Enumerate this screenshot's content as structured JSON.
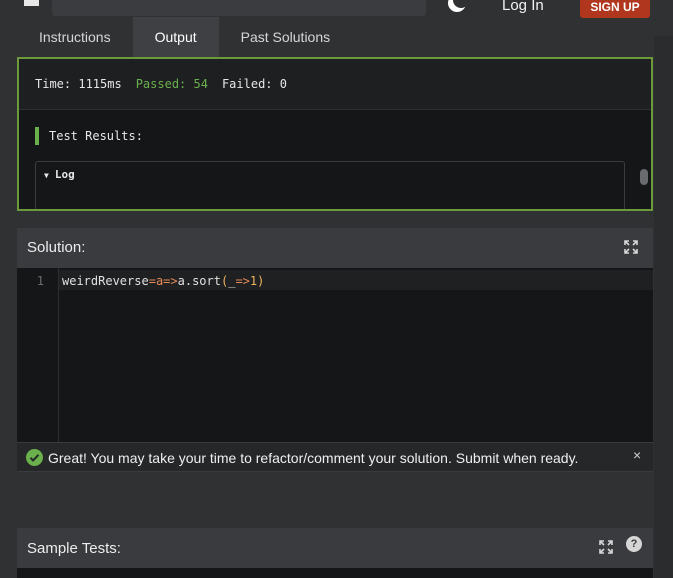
{
  "header": {
    "login_label": "Log In",
    "signup_label": "SIGN UP",
    "signup_color": "#b1361e"
  },
  "tabs": [
    {
      "label": "Instructions",
      "active": false
    },
    {
      "label": "Output",
      "active": true
    },
    {
      "label": "Past Solutions",
      "active": false
    }
  ],
  "output": {
    "time": "Time: 1115ms",
    "passed": "Passed: 54",
    "failed": "Failed: 0",
    "results_title": "Test Results:",
    "log_label": "Log",
    "border_color": "#6c9a3b"
  },
  "solution": {
    "title": "Solution:",
    "line_number": "1",
    "code": {
      "name": "weirdReverse",
      "eq": "=",
      "param": "a",
      "arrow": "=>",
      "obj": "a",
      "method": ".sort",
      "open": "(",
      "inner_param": "_",
      "inner_arrow": "=>",
      "value": "1",
      "close": ")"
    }
  },
  "alert": {
    "message": "Great! You may take your time to refactor/comment your solution. Submit when ready.",
    "close_label": "×",
    "icon": "check-circle-icon"
  },
  "sample_tests": {
    "title": "Sample Tests:",
    "help_label": "?"
  },
  "icons": {
    "moon": "moon-icon",
    "expand": "expand-icon"
  }
}
